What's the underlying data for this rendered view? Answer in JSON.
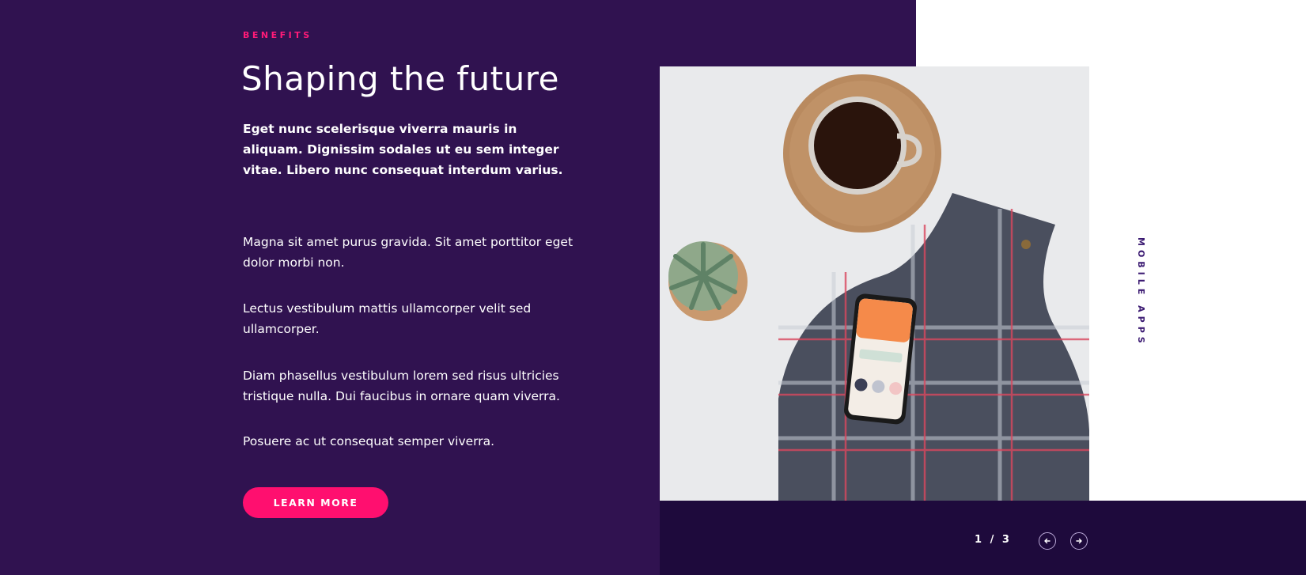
{
  "section": {
    "eyebrow": "BENEFITS",
    "title": "Shaping the future",
    "lead": "Eget nunc scelerisque viverra mauris in aliquam. Dignissim sodales ut eu sem integer vitae. Libero nunc consequat interdum varius.",
    "paragraphs": [
      "Magna sit amet purus gravida. Sit amet porttitor eget dolor morbi non.",
      "Lectus vestibulum mattis ullamcorper velit sed ullamcorper.",
      "Diam phasellus vestibulum lorem sed risus ultricies tristique nulla. Dui faucibus in ornare quam viverra.",
      "Posuere ac ut consequat semper viverra."
    ],
    "button_label": "LEARN MORE"
  },
  "slider": {
    "category_label": "MOBILE APPS",
    "current": "1",
    "separator": "/",
    "total": "3",
    "prev_icon": "arrow-left-icon",
    "next_icon": "arrow-right-icon"
  },
  "colors": {
    "purple_panel": "#301250",
    "dark_bar": "#1e0a3c",
    "accent_pink": "#ff1a78",
    "label_purple": "#3b1a72"
  }
}
